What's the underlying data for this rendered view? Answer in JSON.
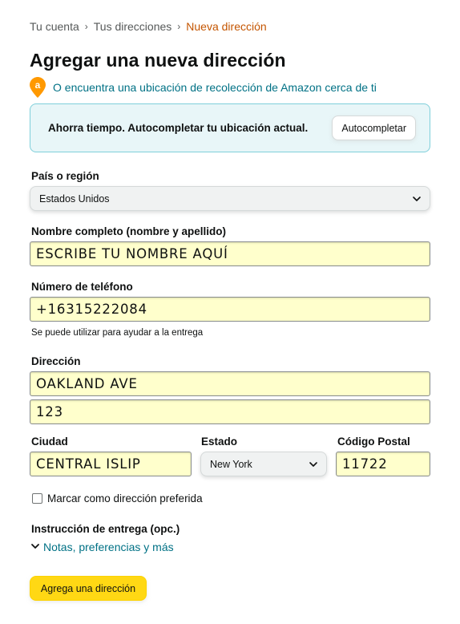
{
  "breadcrumb": {
    "items": [
      "Tu cuenta",
      "Tus direcciones"
    ],
    "current": "Nueva dirección",
    "separator": "›"
  },
  "page": {
    "title": "Agregar una nueva dirección"
  },
  "pickup": {
    "icon_letter": "a",
    "link_text": "O encuentra una ubicación de recolección de Amazon cerca de ti"
  },
  "autofill": {
    "message": "Ahorra tiempo. Autocompletar tu ubicación actual.",
    "button_label": "Autocompletar"
  },
  "form": {
    "country": {
      "label": "País o región",
      "value": "Estados Unidos"
    },
    "full_name": {
      "label": "Nombre completo (nombre y apellido)",
      "value": "ESCRIBE TU NOMBRE AQUÍ"
    },
    "phone": {
      "label": "Número de teléfono",
      "value": "+16315222084",
      "hint": "Se puede utilizar para ayudar a la entrega"
    },
    "address": {
      "label": "Dirección",
      "line1": "OAKLAND AVE",
      "line2": "123"
    },
    "city": {
      "label": "Ciudad",
      "value": "CENTRAL ISLIP"
    },
    "state": {
      "label": "Estado",
      "value": "New York"
    },
    "zip": {
      "label": "Código Postal",
      "value": "11722"
    },
    "default_checkbox": {
      "label": "Marcar como dirección preferida",
      "checked": false
    },
    "delivery_instructions": {
      "label": "Instrucción de entrega (opc.)",
      "link_text": "Notas, preferencias y más"
    },
    "submit_label": "Agrega una dirección"
  },
  "colors": {
    "accent_link": "#007185",
    "breadcrumb_current": "#c45500",
    "input_bg": "#ffffcc",
    "primary_button": "#ffd814",
    "autofill_bg": "#e8f6f8",
    "pickup_icon": "#ff9900"
  }
}
